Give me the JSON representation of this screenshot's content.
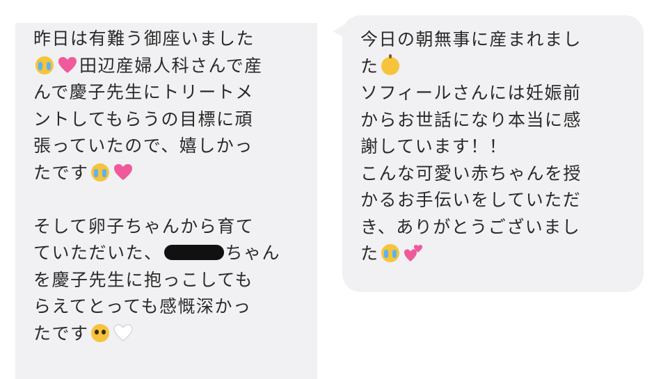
{
  "left_message": {
    "lines": [
      [
        "昨日は有難う御座いました"
      ],
      [
        "",
        "田辺産婦人科さんで産"
      ],
      [
        "んで慶子先生にトリートメ"
      ],
      [
        "ントしてもらうの目標に頑"
      ],
      [
        "張っていたので、嬉しかっ"
      ],
      [
        "たです"
      ],
      [
        ""
      ],
      [
        "そして卵子ちゃんから育て"
      ],
      [
        "ていただいた、",
        "ちゃん"
      ],
      [
        "を慶子先生に抱っこしても"
      ],
      [
        "らえてとっても感慨深かっ"
      ],
      [
        "たです"
      ]
    ]
  },
  "right_message": {
    "lines": [
      [
        "今日の朝無事に産まれまし"
      ],
      [
        "た"
      ],
      [
        "ソフィールさんには妊娠前"
      ],
      [
        "からお世話になり本当に感"
      ],
      [
        "謝しています！！"
      ],
      [
        "こんな可愛い赤ちゃんを授"
      ],
      [
        "かるお手伝いをしていただ"
      ],
      [
        "き、ありがとうございまし"
      ],
      [
        "た"
      ]
    ]
  },
  "emoji_names": {
    "cry": "loudly-crying-face",
    "heart": "growing-heart",
    "baby": "baby-face",
    "two_hearts": "two-hearts",
    "pleading": "pleading-face",
    "white_heart": "white-heart"
  },
  "colors": {
    "bubble_bg": "#f1f1f3",
    "text": "#2a2a2a",
    "heart_pink": "#f05a9a"
  }
}
